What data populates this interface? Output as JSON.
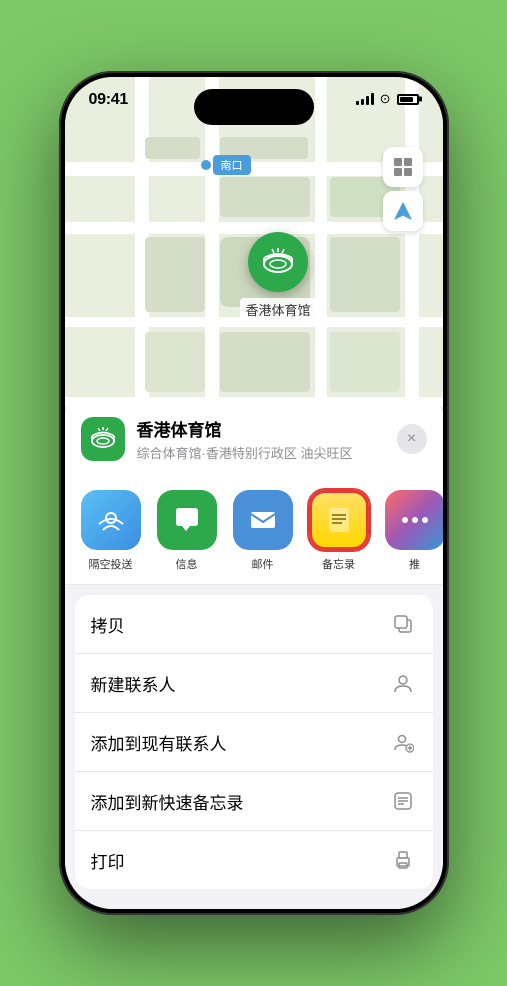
{
  "status_bar": {
    "time": "09:41",
    "location_arrow": "▶"
  },
  "map": {
    "location_label": "南口"
  },
  "venue": {
    "name": "香港体育馆",
    "subtitle": "综合体育馆·香港特别行政区 油尖旺区",
    "pin_label": "香港体育馆"
  },
  "share_items": [
    {
      "label": "隔空投送",
      "type": "airdrop"
    },
    {
      "label": "信息",
      "type": "message"
    },
    {
      "label": "邮件",
      "type": "mail"
    },
    {
      "label": "备忘录",
      "type": "notes"
    },
    {
      "label": "推",
      "type": "more"
    }
  ],
  "actions": [
    {
      "label": "拷贝",
      "icon": "copy"
    },
    {
      "label": "新建联系人",
      "icon": "person-add"
    },
    {
      "label": "添加到现有联系人",
      "icon": "person-plus"
    },
    {
      "label": "添加到新快速备忘录",
      "icon": "note"
    },
    {
      "label": "打印",
      "icon": "print"
    }
  ],
  "close_label": "×"
}
